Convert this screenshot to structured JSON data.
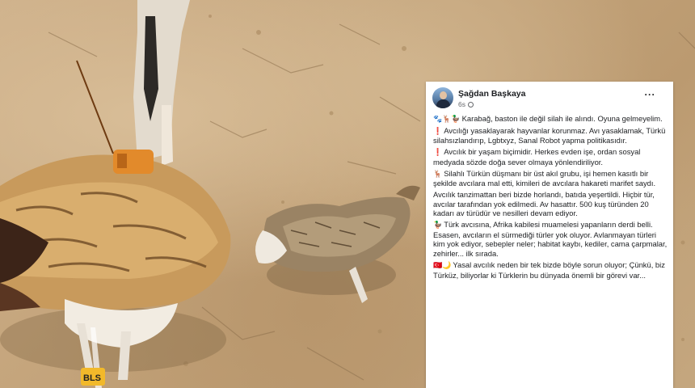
{
  "post": {
    "author": "Şağdan Başkaya",
    "time": "6s",
    "menu": "···",
    "paragraphs": [
      {
        "emoji": "🐾🦌🦆",
        "text": "Karabağ, baston ile değil silah ile alındı. Oyuna gelmeyelim."
      },
      {
        "emoji": "❗",
        "text": "Avcılığı yasaklayarak hayvanlar korunmaz. Avı yasaklamak, Türkü silahsızlandırıp, Lgbtxyz, Sanal Robot yapma politikasıdır."
      },
      {
        "emoji": "❗",
        "text": "Avcılık bir yaşam biçimidir. Herkes evden işe, ordan sosyal medyada sözde doğa sever olmaya yönlendiriliyor."
      },
      {
        "emoji": "🦌",
        "text": "Silahlı Türkün düşmanı bir üst akıl grubu, işi hemen kasıtlı bir şekilde avcılara mal etti, kimileri de avcılara hakareti marifet saydı."
      },
      {
        "emoji": "",
        "text": "Avcılık tanzimattan beri bizde horlandı, batıda yeşertildi. Hiçbir tür, avcılar tarafından yok edilmedi. Av hasattır. 500 kuş türünden 20 kadarı av türüdür ve nesilleri devam ediyor."
      },
      {
        "emoji": "🦆",
        "text": "Türk avcısına, Afrika kabilesi muamelesi yapanların derdi belli. Esasen, avcıların el sürmediği türler yok oluyor. Avlanmayan türleri kim yok ediyor, sebepler neler; habitat kaybı, kediler, cama çarpmalar, zehirler... ilk sırada."
      },
      {
        "emoji": "🇹🇷🌙",
        "text": "Yasal avcılık neden bir tek bizde böyle sorun oluyor; Çünkü, biz Türküz, biliyorlar ki Türklerin bu dünyada önemli bir görevi var..."
      }
    ]
  },
  "photo": {
    "tag_text": "BLS"
  }
}
